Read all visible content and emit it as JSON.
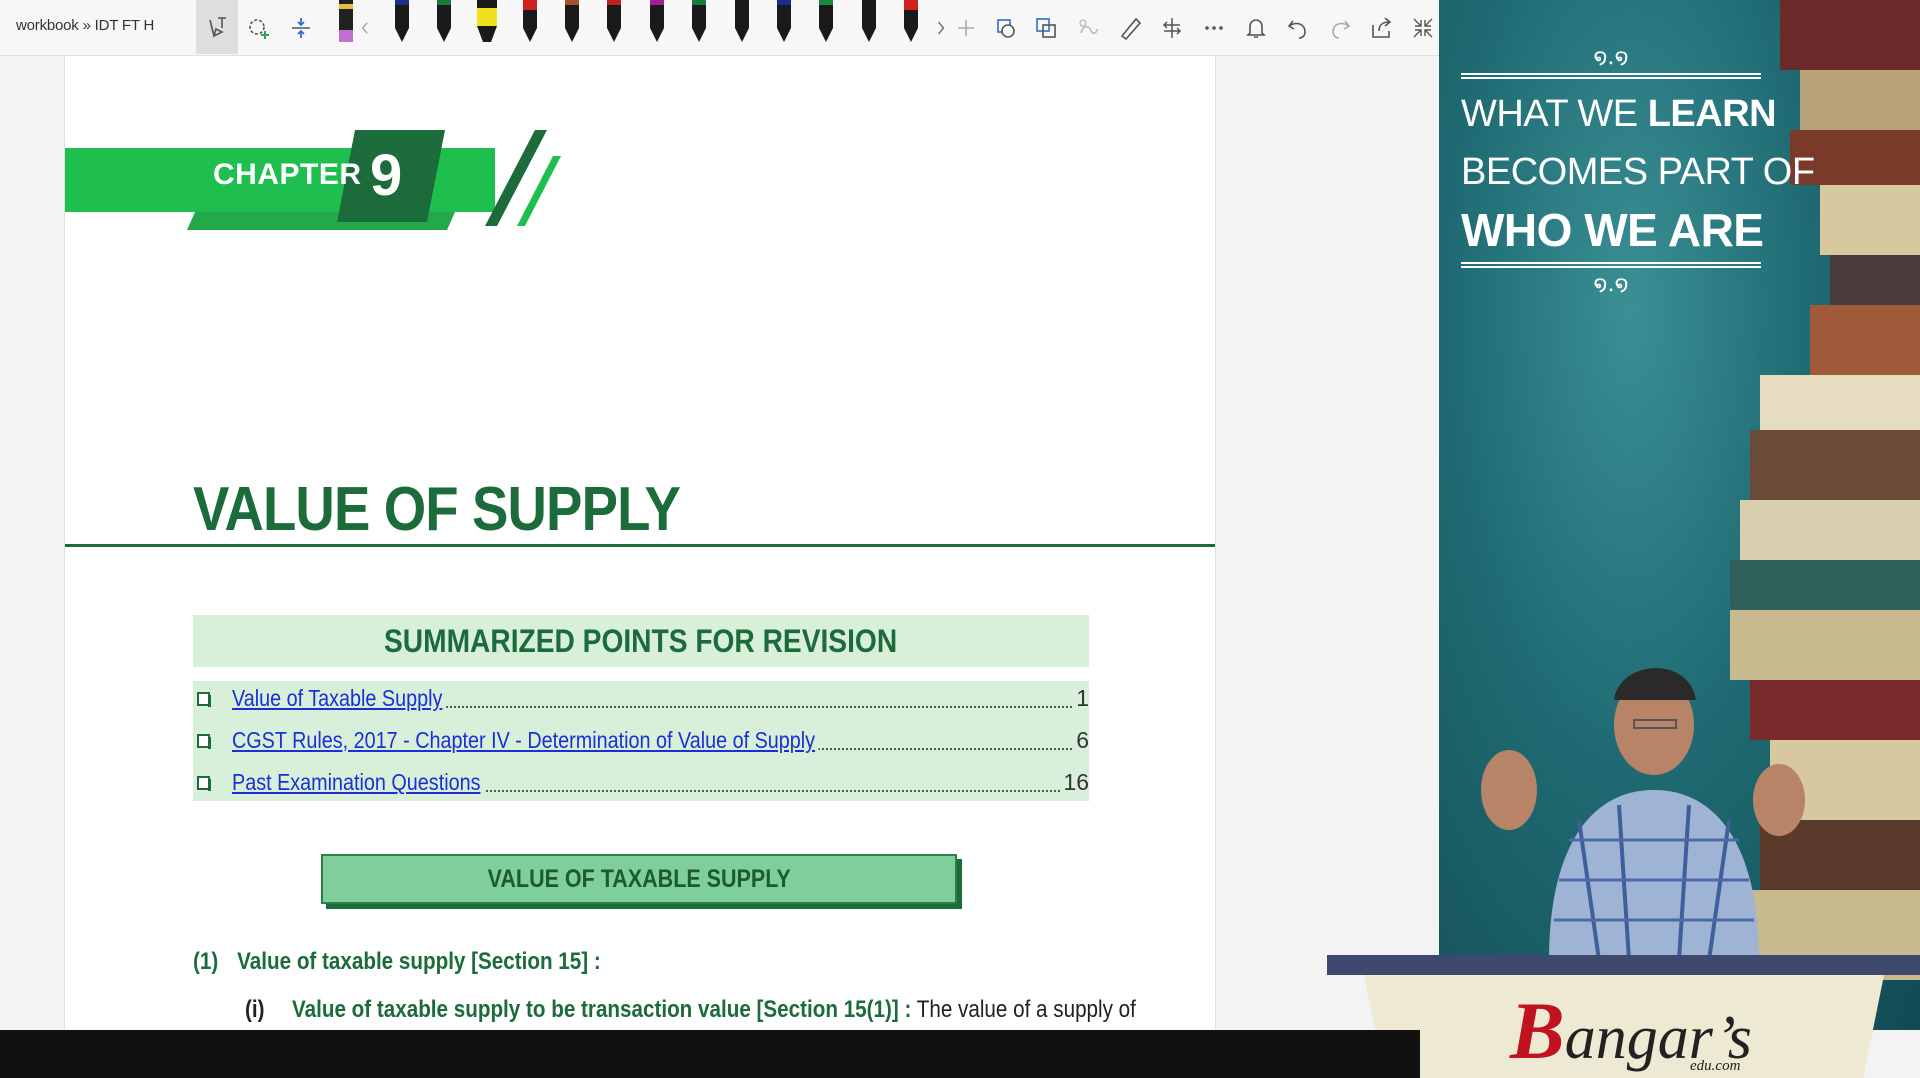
{
  "toolbar": {
    "breadcrumb": "workbook » IDT FT H",
    "pen_colors": [
      "#c070d0",
      "#1e2f8a",
      "#1a1a1a",
      "#f0e020",
      "#d02020",
      "#a0522d",
      "#c02020",
      "#a02090",
      "#1a7a3a",
      "#1a1a1a",
      "#1a2f8a",
      "#1a8a3a",
      "#1a1a1a",
      "#d02020"
    ],
    "icons": [
      "lasso-select-icon",
      "add-shape-icon",
      "insert-space-icon",
      "highlighter-icon",
      "scroll-left-icon",
      "scroll-right-icon",
      "add-pen-icon",
      "ink-to-shape-icon",
      "ink-to-text-icon",
      "ink-replay-icon",
      "ruler-icon",
      "align-icon",
      "more-icon",
      "bell-icon",
      "undo-icon",
      "redo-icon",
      "share-icon",
      "collapse-icon"
    ]
  },
  "document": {
    "chapter_word": "CHAPTER",
    "chapter_number": "9",
    "title": "VALUE OF SUPPLY",
    "summary_heading": "SUMMARIZED POINTS FOR REVISION",
    "toc": [
      {
        "label": "Value of Taxable Supply",
        "page": "1"
      },
      {
        "label": "CGST Rules, 2017 - Chapter IV - Determination of Value of Supply",
        "page": "6"
      },
      {
        "label": "Past Examination Questions",
        "page": "16"
      }
    ],
    "section_heading": "VALUE OF TAXABLE SUPPLY",
    "para1_num": "(1)",
    "para1_text": "Value of taxable supply [Section 15] :",
    "para2_num": "(i)",
    "para2_bold": "Value of taxable supply to be transaction value [Section 15(1)] :",
    "para2_text": " The value of a supply of"
  },
  "video": {
    "quote_line1_light": "WHAT WE ",
    "quote_line1_bold": "LEARN",
    "quote_line2": "BECOMES PART OF",
    "quote_line3": "WHO WE ARE",
    "logo_initial": "B",
    "logo_rest": "angar’s",
    "logo_sub": "edu.com"
  },
  "colors": {
    "brand_green": "#1c6b3a",
    "banner_green": "#1fbf4f",
    "toc_bg": "#d8f0d9",
    "link_blue": "#1a2fd6",
    "logo_red": "#c1121f"
  }
}
